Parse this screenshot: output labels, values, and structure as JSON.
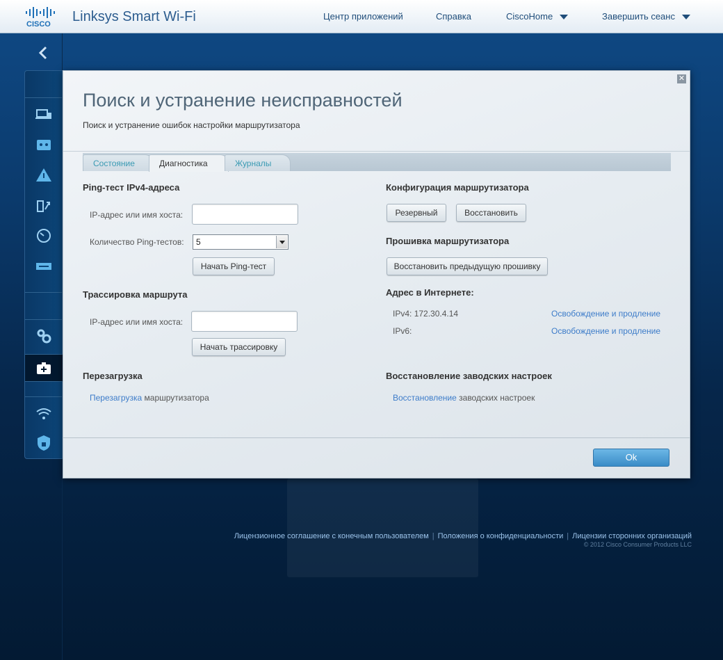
{
  "header": {
    "logo_text": "CISCO",
    "brand": "Linksys Smart Wi-Fi",
    "nav": {
      "app_center": "Центр приложений",
      "help": "Справка",
      "home_network": "CiscoHome",
      "logout": "Завершить сеанс"
    }
  },
  "sidebar": {
    "icons": [
      "back-arrow-icon",
      "devices-icon",
      "parental-controls-icon",
      "warning-icon",
      "media-prioritization-icon",
      "speed-test-icon",
      "usb-storage-icon",
      "settings-gears-icon",
      "troubleshooting-icon",
      "wireless-icon",
      "security-icon"
    ]
  },
  "modal": {
    "title": "Поиск и устранение неисправностей",
    "subtitle": "Поиск и устранение ошибок настройки маршрутизатора",
    "close": "✕",
    "tabs": [
      "Состояние",
      "Диагностика",
      "Журналы"
    ],
    "active_tab": "Диагностика",
    "ping": {
      "title": "Ping-тест IPv4-адреса",
      "host_label": "IP-адрес или имя хоста:",
      "host_value": "",
      "count_label": "Количество Ping-тестов:",
      "count_value": "5",
      "button": "Начать Ping-тест"
    },
    "traceroute": {
      "title": "Трассировка маршрута",
      "host_label": "IP-адрес или имя хоста:",
      "host_value": "",
      "button": "Начать трассировку"
    },
    "reboot": {
      "title": "Перезагрузка",
      "link": "Перезагрузка",
      "text": "маршрутизатора"
    },
    "router_config": {
      "title": "Конфигурация маршрутизатора",
      "backup_button": "Резервный",
      "restore_button": "Восстановить"
    },
    "firmware": {
      "title": "Прошивка маршрутизатора",
      "button": "Восстановить предыдущую прошивку"
    },
    "internet_address": {
      "title": "Адрес в Интернете:",
      "ipv4_label": "IPv4:",
      "ipv4_value": "172.30.4.14",
      "ipv4_action": "Освобождение и продление",
      "ipv6_label": "IPv6:",
      "ipv6_value": "",
      "ipv6_action": "Освобождение и продление"
    },
    "factory_reset": {
      "title": "Восстановление заводских настроек",
      "link": "Восстановление",
      "text": "заводских настроек"
    },
    "ok_button": "Ok"
  },
  "footer": {
    "eula": "Лицензионное соглашение с конечным пользователем",
    "privacy": "Положения о конфиденциальности",
    "third_party": "Лицензии сторонних организаций",
    "copyright": "© 2012 Cisco Consumer Products LLC"
  },
  "colors": {
    "accent_link": "#3d7cc9",
    "tab_text": "#3a9ab3",
    "ok_button": "#3a8cc7",
    "background": "#0b3a6c"
  }
}
